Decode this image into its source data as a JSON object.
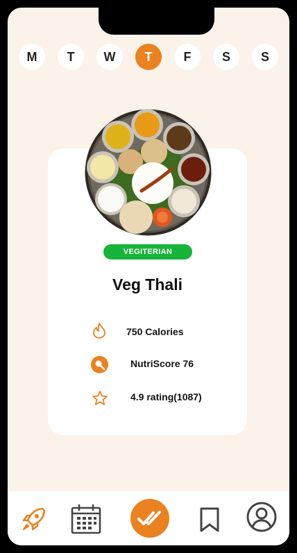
{
  "days": [
    {
      "label": "M",
      "active": false
    },
    {
      "label": "T",
      "active": false
    },
    {
      "label": "W",
      "active": false
    },
    {
      "label": "T",
      "active": true
    },
    {
      "label": "F",
      "active": false
    },
    {
      "label": "S",
      "active": false
    },
    {
      "label": "S",
      "active": false
    }
  ],
  "meal": {
    "badge": "VEGITERIAN",
    "name": "Veg Thali",
    "calories": "750 Calories",
    "nutriscore": "NutriScore 76",
    "rating": "4.9 rating(1087)"
  },
  "nav": {
    "items": [
      "rocket-icon",
      "calendar-icon",
      "double-check-icon",
      "bookmark-icon",
      "profile-icon"
    ]
  },
  "colors": {
    "accent": "#e9821f",
    "badge": "#17b43a",
    "background": "#fbf2ea"
  }
}
